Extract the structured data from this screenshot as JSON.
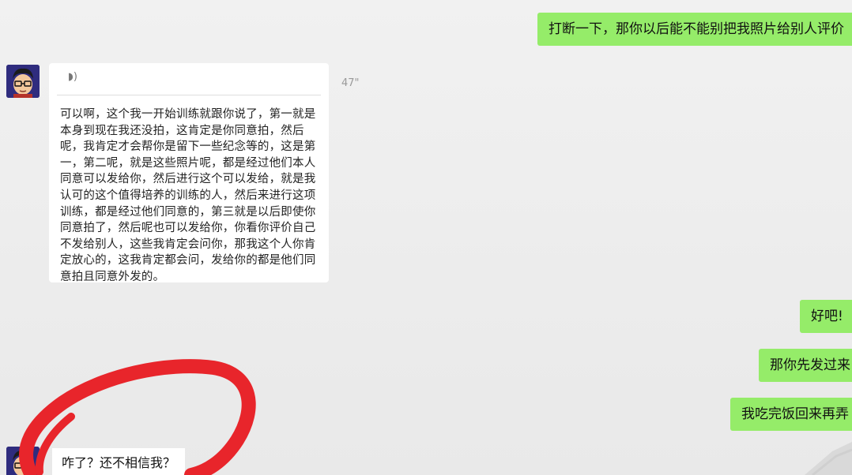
{
  "messages": {
    "out_1": "打断一下，那你以后能不能别把我照片给别人评价",
    "voice": {
      "icon": "speaker-wave-icon",
      "duration": "47\"",
      "transcript": "可以啊，这个我一开始训练就跟你说了，第一就是本身到现在我还没拍，这肯定是你同意拍，然后呢，我肯定才会帮你是留下一些纪念等的，这是第一，第二呢，就是这些照片呢，都是经过他们本人同意可以发给你，然后进行这个可以发给，就是我认可的这个值得培养的训练的人，然后来进行这项训练，都是经过他们同意的，第三就是以后即使你同意拍了，然后呢也可以发给你，你看你评价自己不发给别人，这些我肯定会问你，那我这个人你肯定放心的，这我肯定都会问，发给你的都是他们同意拍且同意外发的。"
    },
    "out_2": "好吧!",
    "out_3": "那你先发过来",
    "out_4": "我吃完饭回来再弄",
    "in_last": "咋了？还不相信我？"
  },
  "colors": {
    "outgoing_bubble": "#95ec69",
    "incoming_bubble": "#ffffff",
    "background": "#ececec",
    "annotation_circle": "#e8252b"
  }
}
